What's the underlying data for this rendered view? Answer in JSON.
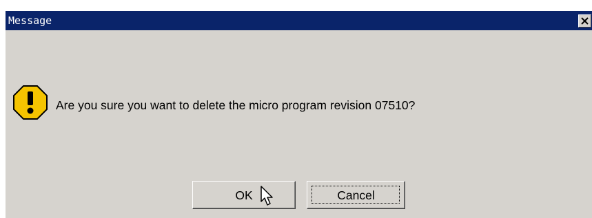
{
  "dialog": {
    "title": "Message",
    "close_glyph": "✕",
    "icon": "warning-icon",
    "message": "Are you sure you want to delete the micro program revision 07510?",
    "buttons": {
      "ok_label": "OK",
      "cancel_label": "Cancel"
    }
  },
  "colors": {
    "titlebar": "#0a246a",
    "dialog_bg": "#d6d3ce",
    "warning_fill": "#f5c400"
  }
}
